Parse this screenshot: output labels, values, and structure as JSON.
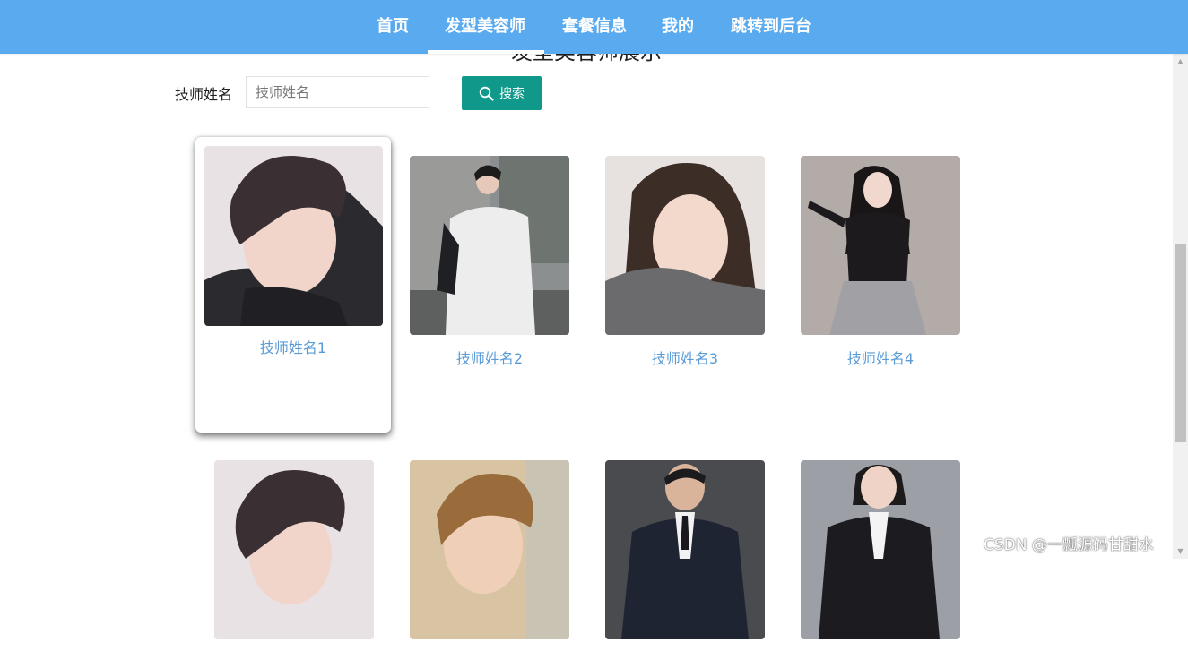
{
  "nav": {
    "items": [
      {
        "label": "首页"
      },
      {
        "label": "发型美容师"
      },
      {
        "label": "套餐信息"
      },
      {
        "label": "我的"
      },
      {
        "label": "跳转到后台"
      }
    ],
    "active_index": 1
  },
  "page_title": "发型美容师展示",
  "search": {
    "label": "技师姓名",
    "placeholder": "技师姓名",
    "value": "",
    "button_label": "搜索",
    "button_icon": "search-icon"
  },
  "cards": [
    {
      "name": "技师姓名1"
    },
    {
      "name": "技师姓名2"
    },
    {
      "name": "技师姓名3"
    },
    {
      "name": "技师姓名4"
    },
    {
      "name": ""
    },
    {
      "name": ""
    },
    {
      "name": ""
    },
    {
      "name": ""
    }
  ],
  "colors": {
    "nav_bg": "#5aaaf0",
    "search_button_bg": "#10998a",
    "card_name": "#5a9bd6"
  },
  "watermark": "CSDN @一瓢源码甘甜水"
}
